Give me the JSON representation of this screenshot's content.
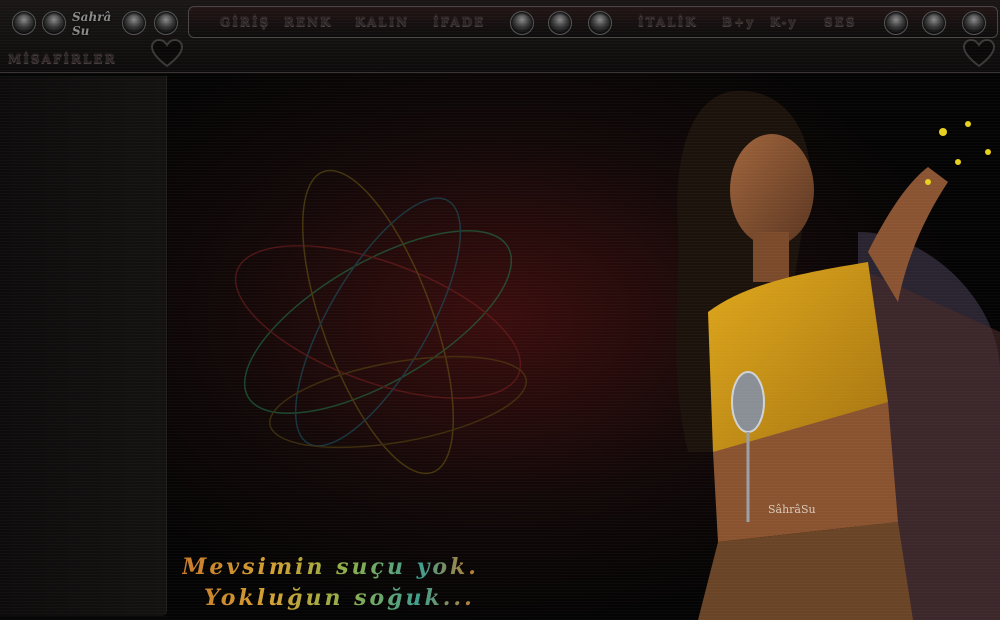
{
  "logo": {
    "text": "Sahrâ Su"
  },
  "menu": {
    "items": [
      {
        "id": "giris",
        "label": "GİRİŞ"
      },
      {
        "id": "renk",
        "label": "RENK"
      },
      {
        "id": "kalin",
        "label": "KALIN"
      },
      {
        "id": "ifade",
        "label": "İFADE"
      },
      {
        "id": "italik",
        "label": "İTALİK"
      },
      {
        "id": "bplus",
        "label": "B+y"
      },
      {
        "id": "kminus",
        "label": "K-y"
      },
      {
        "id": "ses",
        "label": "SES"
      }
    ]
  },
  "guests": {
    "label": "MİSAFİRLER"
  },
  "artwork": {
    "watermark": "SâhrâSu"
  },
  "poem": {
    "line1": "Mevsimin suçu yok.",
    "line2": "Yokluğun soğuk..."
  },
  "colors": {
    "accent_gold": "#d4a032",
    "accent_teal": "#3f9e8f",
    "top_yellow": "#e0a81c"
  },
  "icons": [
    "knob-button-icon",
    "heart-icon"
  ]
}
